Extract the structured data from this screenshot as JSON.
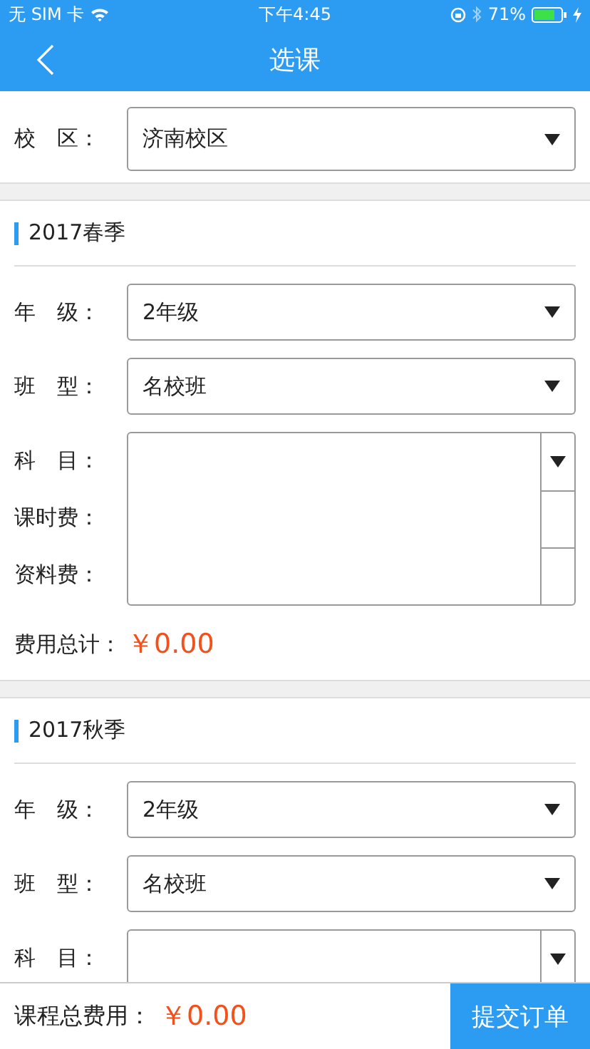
{
  "status_bar": {
    "carrier": "无 SIM 卡",
    "time": "下午4:45",
    "battery": "71%"
  },
  "nav": {
    "title": "选课"
  },
  "campus": {
    "label": "校　区：",
    "value": "济南校区"
  },
  "sections": [
    {
      "title": "2017春季",
      "fields": [
        {
          "kind": "select",
          "label": "年　级：",
          "value": "2年级"
        },
        {
          "kind": "select",
          "label": "班　型：",
          "value": "名校班"
        },
        {
          "kind": "subject",
          "labels": [
            "科　目：",
            "课时费：",
            "资料费："
          ]
        }
      ],
      "total": {
        "label": "费用总计：",
        "value": "￥0.00"
      }
    },
    {
      "title": "2017秋季",
      "fields": [
        {
          "kind": "select",
          "label": "年　级：",
          "value": "2年级"
        },
        {
          "kind": "select",
          "label": "班　型：",
          "value": "名校班"
        },
        {
          "kind": "subject",
          "labels": [
            "科　目："
          ]
        }
      ]
    }
  ],
  "bottom_bar": {
    "label": "课程总费用：",
    "value": "￥0.00",
    "button": "提交订单"
  }
}
